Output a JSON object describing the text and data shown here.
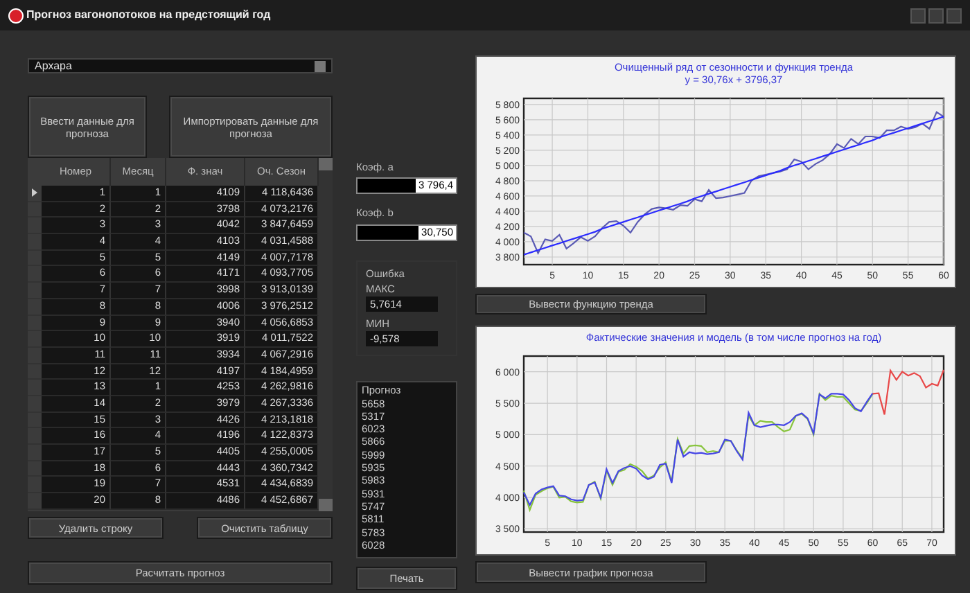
{
  "window": {
    "title": "Прогноз вагонопотоков на предстоящий год"
  },
  "station_select": {
    "value": "Архара"
  },
  "input_buttons": [
    "Ввести данные для прогноза",
    "Импортировать данные для прогноза"
  ],
  "table": {
    "columns": [
      "Номер",
      "Месяц",
      "Ф. знач",
      "Оч. Сезон"
    ],
    "rows": [
      {
        "selected": true,
        "cells": [
          "1",
          "1",
          "4109",
          "4 118,6436"
        ]
      },
      {
        "selected": false,
        "cells": [
          "2",
          "2",
          "3798",
          "4 073,2176"
        ]
      },
      {
        "selected": false,
        "cells": [
          "3",
          "3",
          "4042",
          "3 847,6459"
        ]
      },
      {
        "selected": false,
        "cells": [
          "4",
          "4",
          "4103",
          "4 031,4588"
        ]
      },
      {
        "selected": false,
        "cells": [
          "5",
          "5",
          "4149",
          "4 007,7178"
        ]
      },
      {
        "selected": false,
        "cells": [
          "6",
          "6",
          "4171",
          "4 093,7705"
        ]
      },
      {
        "selected": false,
        "cells": [
          "7",
          "7",
          "3998",
          "3 913,0139"
        ]
      },
      {
        "selected": false,
        "cells": [
          "8",
          "8",
          "4006",
          "3 976,2512"
        ]
      },
      {
        "selected": false,
        "cells": [
          "9",
          "9",
          "3940",
          "4 056,6853"
        ]
      },
      {
        "selected": false,
        "cells": [
          "10",
          "10",
          "3919",
          "4 011,7522"
        ]
      },
      {
        "selected": false,
        "cells": [
          "11",
          "11",
          "3934",
          "4 067,2916"
        ]
      },
      {
        "selected": false,
        "cells": [
          "12",
          "12",
          "4197",
          "4 184,4959"
        ]
      },
      {
        "selected": false,
        "cells": [
          "13",
          "1",
          "4253",
          "4 262,9816"
        ]
      },
      {
        "selected": false,
        "cells": [
          "14",
          "2",
          "3979",
          "4 267,3336"
        ]
      },
      {
        "selected": false,
        "cells": [
          "15",
          "3",
          "4426",
          "4 213,1818"
        ]
      },
      {
        "selected": false,
        "cells": [
          "16",
          "4",
          "4196",
          "4 122,8373"
        ]
      },
      {
        "selected": false,
        "cells": [
          "17",
          "5",
          "4405",
          "4 255,0005"
        ]
      },
      {
        "selected": false,
        "cells": [
          "18",
          "6",
          "4443",
          "4 360,7342"
        ]
      },
      {
        "selected": false,
        "cells": [
          "19",
          "7",
          "4531",
          "4 434,6839"
        ]
      },
      {
        "selected": false,
        "cells": [
          "20",
          "8",
          "4486",
          "4 452,6867"
        ]
      }
    ]
  },
  "table_buttons": [
    "Удалить строку",
    "Очистить таблицу"
  ],
  "calculate_button": "Расчитать прогноз",
  "coefficients": [
    {
      "label": "Коэф. a",
      "value": "3 796,4"
    },
    {
      "label": "Коэф. b",
      "value": "30,750"
    }
  ],
  "error_group": {
    "title": "Ошибка",
    "fields": [
      {
        "label": "МАКС",
        "value": "5,7614"
      },
      {
        "label": "МИН",
        "value": "-9,578"
      }
    ]
  },
  "forecast_list": {
    "header": "Прогноз",
    "items": [
      "5658",
      "5317",
      "6023",
      "5866",
      "5999",
      "5935",
      "5983",
      "5931",
      "5747",
      "5811",
      "5783",
      "6028"
    ]
  },
  "print_button": "Печать",
  "trend_chart": {
    "chart_data": {
      "type": "line",
      "title": "Очищенный ряд от сезонности и функция тренда",
      "annotations": [
        "y = 30,76x + 3796,37"
      ],
      "x": [
        1,
        2,
        3,
        4,
        5,
        6,
        7,
        8,
        9,
        10,
        11,
        12,
        13,
        14,
        15,
        16,
        17,
        18,
        19,
        20,
        21,
        22,
        23,
        24,
        25,
        26,
        27,
        28,
        29,
        30,
        31,
        32,
        33,
        34,
        35,
        36,
        37,
        38,
        39,
        40,
        41,
        42,
        43,
        44,
        45,
        46,
        47,
        48,
        49,
        50,
        51,
        52,
        53,
        54,
        55,
        56,
        57,
        58,
        59,
        60
      ],
      "xlim": [
        1,
        60
      ],
      "ylim": [
        3700,
        5880
      ],
      "xticks": [
        5,
        10,
        15,
        20,
        25,
        30,
        35,
        40,
        45,
        50,
        55,
        60
      ],
      "yticks": [
        {
          "value": 3800,
          "label": "3 800"
        },
        {
          "value": 4000,
          "label": "4 000"
        },
        {
          "value": 4200,
          "label": "4 200"
        },
        {
          "value": 4400,
          "label": "4 400"
        },
        {
          "value": 4600,
          "label": "4 600"
        },
        {
          "value": 4800,
          "label": "4 800"
        },
        {
          "value": 5000,
          "label": "5 000"
        },
        {
          "value": 5200,
          "label": "5 200"
        },
        {
          "value": 5400,
          "label": "5 400"
        },
        {
          "value": 5600,
          "label": "5 600"
        },
        {
          "value": 5800,
          "label": "5 800"
        }
      ],
      "series": [
        {
          "color": "#5a5ab4",
          "values": [
            4120,
            4070,
            3850,
            4030,
            4010,
            4090,
            3910,
            3980,
            4060,
            4010,
            4070,
            4180,
            4260,
            4270,
            4210,
            4120,
            4260,
            4360,
            4430,
            4450,
            4440,
            4420,
            4480,
            4470,
            4560,
            4530,
            4680,
            4570,
            4580,
            4600,
            4620,
            4640,
            4800,
            4860,
            4880,
            4900,
            4920,
            4950,
            5080,
            5050,
            4950,
            5020,
            5070,
            5150,
            5280,
            5230,
            5350,
            5280,
            5380,
            5380,
            5360,
            5460,
            5460,
            5510,
            5480,
            5500,
            5550,
            5480,
            5700,
            5640
          ]
        },
        {
          "color": "#2b2bff",
          "values": [
            3830,
            3860,
            3890,
            3920,
            3950,
            3980,
            4010,
            4040,
            4070,
            4100,
            4130,
            4170,
            4200,
            4230,
            4260,
            4290,
            4320,
            4350,
            4380,
            4410,
            4440,
            4470,
            4500,
            4530,
            4570,
            4600,
            4630,
            4660,
            4690,
            4720,
            4750,
            4780,
            4810,
            4840,
            4870,
            4900,
            4930,
            4970,
            5000,
            5030,
            5060,
            5090,
            5120,
            5150,
            5180,
            5210,
            5240,
            5270,
            5300,
            5330,
            5370,
            5400,
            5430,
            5460,
            5490,
            5520,
            5550,
            5580,
            5610,
            5640
          ]
        }
      ],
      "grid": true
    },
    "button": "Вывести функцию тренда"
  },
  "forecast_chart": {
    "chart_data": {
      "type": "line",
      "title": "Фактические значения и модель (в том числе прогноз на год)",
      "x": [
        1,
        2,
        3,
        4,
        5,
        6,
        7,
        8,
        9,
        10,
        11,
        12,
        13,
        14,
        15,
        16,
        17,
        18,
        19,
        20,
        21,
        22,
        23,
        24,
        25,
        26,
        27,
        28,
        29,
        30,
        31,
        32,
        33,
        34,
        35,
        36,
        37,
        38,
        39,
        40,
        41,
        42,
        43,
        44,
        45,
        46,
        47,
        48,
        49,
        50,
        51,
        52,
        53,
        54,
        55,
        56,
        57,
        58,
        59,
        60,
        61,
        62,
        63,
        64,
        65,
        66,
        67,
        68,
        69,
        70,
        71,
        72
      ],
      "xlim": [
        1,
        72
      ],
      "ylim": [
        3450,
        6250
      ],
      "xticks": [
        5,
        10,
        15,
        20,
        25,
        30,
        35,
        40,
        45,
        50,
        55,
        60,
        65,
        70
      ],
      "yticks": [
        {
          "value": 3500,
          "label": "3 500"
        },
        {
          "value": 4000,
          "label": "4 000"
        },
        {
          "value": 4500,
          "label": "4 500"
        },
        {
          "value": 5000,
          "label": "5 000"
        },
        {
          "value": 5500,
          "label": "5 500"
        },
        {
          "value": 6000,
          "label": "6 000"
        }
      ],
      "series": [
        {
          "color": "#88c43c",
          "values": [
            4110,
            3800,
            4040,
            4100,
            4150,
            4170,
            4000,
            4010,
            3940,
            3920,
            3930,
            4200,
            4250,
            3980,
            4430,
            4200,
            4410,
            4440,
            4530,
            4490,
            4420,
            4300,
            4350,
            4480,
            4560,
            4250,
            4930,
            4700,
            4820,
            4830,
            4820,
            4720,
            4740,
            4720,
            4900,
            4900,
            4750,
            4620,
            5300,
            5150,
            5220,
            5200,
            5200,
            5120,
            5050,
            5080,
            5300,
            5330,
            5250,
            5000,
            5650,
            5550,
            5620,
            5600,
            5600,
            5500,
            5400,
            5380,
            5500,
            5650,
            null,
            null,
            null,
            null,
            null,
            null,
            null,
            null,
            null,
            null,
            null,
            null
          ]
        },
        {
          "color": "#4646e6",
          "values": [
            4080,
            3880,
            4060,
            4130,
            4160,
            4180,
            4030,
            4020,
            3970,
            3950,
            3960,
            4200,
            4240,
            4000,
            4450,
            4230,
            4420,
            4470,
            4500,
            4460,
            4350,
            4290,
            4330,
            4520,
            4540,
            4230,
            4920,
            4650,
            4720,
            4700,
            4710,
            4690,
            4700,
            4720,
            4920,
            4900,
            4740,
            4600,
            5350,
            5150,
            5120,
            5140,
            5160,
            5160,
            5150,
            5200,
            5300,
            5340,
            5260,
            5020,
            5640,
            5580,
            5650,
            5650,
            5640,
            5550,
            5420,
            5370,
            5520,
            5660,
            null,
            null,
            null,
            null,
            null,
            null,
            null,
            null,
            null,
            null,
            null,
            null
          ]
        },
        {
          "color": "#e84848",
          "values": [
            null,
            null,
            null,
            null,
            null,
            null,
            null,
            null,
            null,
            null,
            null,
            null,
            null,
            null,
            null,
            null,
            null,
            null,
            null,
            null,
            null,
            null,
            null,
            null,
            null,
            null,
            null,
            null,
            null,
            null,
            null,
            null,
            null,
            null,
            null,
            null,
            null,
            null,
            null,
            null,
            null,
            null,
            null,
            null,
            null,
            null,
            null,
            null,
            null,
            null,
            null,
            null,
            null,
            null,
            null,
            null,
            null,
            null,
            null,
            5650,
            5660,
            5320,
            6020,
            5870,
            6000,
            5940,
            5980,
            5930,
            5750,
            5810,
            5780,
            6030
          ]
        }
      ],
      "grid": true
    },
    "button": "Вывести график прогноза"
  }
}
